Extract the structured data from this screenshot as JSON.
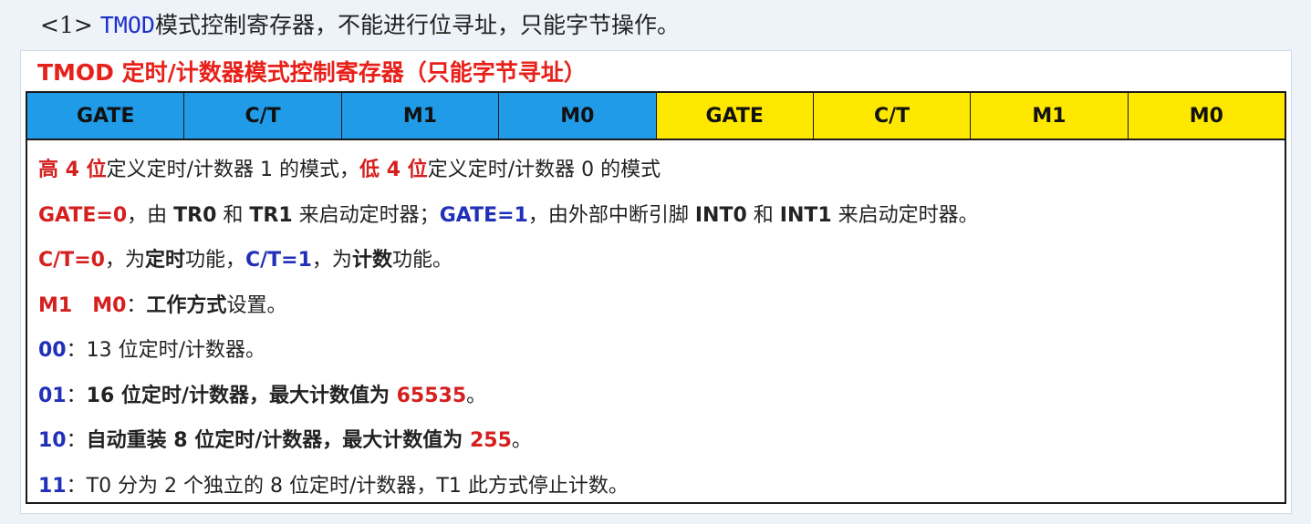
{
  "heading": {
    "prefix": "<1> ",
    "keyword": "TMOD",
    "rest": "模式控制寄存器，不能进行位寻址，只能字节操作。"
  },
  "panel": {
    "title": "TMOD 定时/计数器模式控制寄存器（只能字节寻址）",
    "register_bits": [
      "GATE",
      "C/T",
      "M1",
      "M0",
      "GATE",
      "C/T",
      "M1",
      "M0"
    ],
    "bit_colors": {
      "high_nibble": "#1f9be8",
      "low_nibble": "#ffe800"
    },
    "lines": {
      "l1": {
        "a": "高 4 位",
        "b": "定义定时/计数器 1 的模式，",
        "c": "低 4 位",
        "d": "定义定时/计数器 0 的模式"
      },
      "l2": {
        "a": "GATE=0",
        "b": "，由 ",
        "c": "TR0",
        "d": " 和 ",
        "e": "TR1",
        "f": " 来启动定时器；",
        "g": "GATE=1",
        "h": "，由外部中断引脚 ",
        "i": "INT0",
        "j": " 和 ",
        "k": "INT1",
        "l": " 来启动定时器。"
      },
      "l3": {
        "a": "C/T=0",
        "b": "，为",
        "c": "定时",
        "d": "功能，",
        "e": "C/T=1",
        "f": "，为",
        "g": "计数",
        "h": "功能。"
      },
      "l4": {
        "a": "M1　M0",
        "b": "：",
        "c": "工作方式",
        "d": "设置。"
      },
      "l5": {
        "a": "00",
        "b": "：13 位定时/计数器。"
      },
      "l6": {
        "a": "01",
        "b": "：",
        "c": "16 位定时/计数器，最大计数值为 ",
        "d": "65535",
        "e": "。"
      },
      "l7": {
        "a": "10",
        "b": "：",
        "c": "自动重装 8 位定时/计数器，最大计数值为 ",
        "d": "255",
        "e": "。"
      },
      "l8": {
        "a": "11",
        "b": "：T0 分为 2 个独立的 8 位定时/计数器，T1 此方式停止计数。"
      }
    }
  }
}
